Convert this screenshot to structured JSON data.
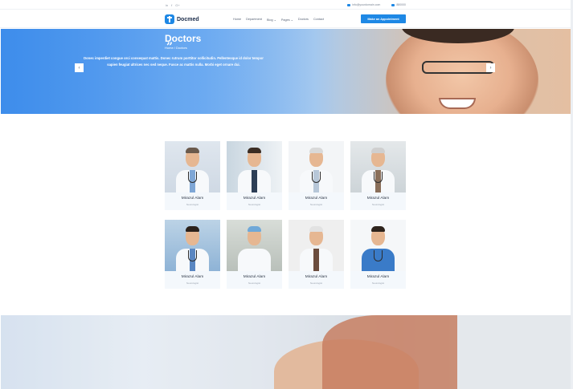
{
  "topbar": {
    "social": [
      "in",
      "f",
      "G+"
    ],
    "email": "info@yourdomain.com",
    "phone": "880000"
  },
  "header": {
    "logo_text": "Docmed",
    "nav": [
      "Home",
      "Department",
      "Blog ⌄",
      "Pages ⌄",
      "Doctors",
      "Contact"
    ],
    "cta_label": "Make an Appointment",
    "accent_color": "#1e88e5"
  },
  "hero": {
    "title": "Doctors",
    "breadcrumb": "Home / Doctors"
  },
  "doctors": [
    {
      "name": "Mirazul Alam",
      "role": "Neurologist"
    },
    {
      "name": "Mirazul Alam",
      "role": "Neurologist"
    },
    {
      "name": "Mirazul Alam",
      "role": "Neurologist"
    },
    {
      "name": "Mirazul Alam",
      "role": "Neurologist"
    },
    {
      "name": "Mirazul Alam",
      "role": "Neurologist"
    },
    {
      "name": "Mirazul Alam",
      "role": "Neurologist"
    },
    {
      "name": "Mirazul Alam",
      "role": "Neurologist"
    },
    {
      "name": "Mirazul Alam",
      "role": "Neurologist"
    }
  ],
  "testimonial": {
    "quote_mark": "”",
    "text": "Donec imperdiet congue orci consequat mattis. Donec rutrum porttitor sollicitudin. Pellentesque id dolor tempor sapien feugiat ultrices nec sed neque. Fusce ac mattis nulla. Morbi eget ornare dui.",
    "prev_icon": "chevron-left-icon",
    "next_icon": "chevron-right-icon"
  }
}
